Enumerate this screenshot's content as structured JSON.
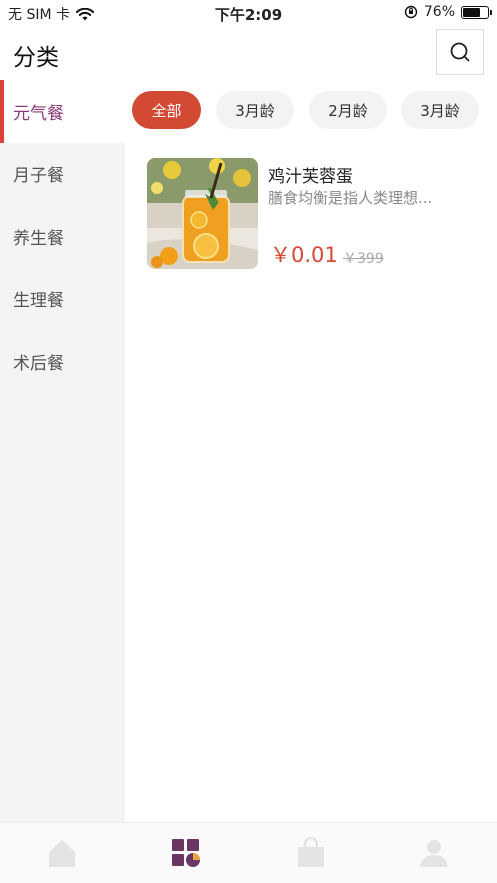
{
  "status_bar": {
    "carrier": "无 SIM 卡",
    "time": "下午2:09",
    "battery": "76%",
    "battery_level": 0.76
  },
  "header": {
    "title": "分类"
  },
  "sidebar": {
    "items": [
      {
        "label": "元气餐",
        "active": true
      },
      {
        "label": "月子餐",
        "active": false
      },
      {
        "label": "养生餐",
        "active": false
      },
      {
        "label": "生理餐",
        "active": false
      },
      {
        "label": "术后餐",
        "active": false
      }
    ]
  },
  "filters": {
    "chips": [
      {
        "label": "全部",
        "active": true
      },
      {
        "label": "3月龄",
        "active": false
      },
      {
        "label": "2月龄",
        "active": false
      },
      {
        "label": "3月龄",
        "active": false
      }
    ]
  },
  "product": {
    "name": "鸡汁芙蓉蛋",
    "description": "膳食均衡是指人类理想...",
    "price": "￥0.01",
    "original_price": "￥399"
  },
  "colors": {
    "accent": "#d24a33",
    "sidebar_active_text": "#8a3a78",
    "sidebar_indicator": "#e0413a",
    "tab_active": "#6b3564"
  },
  "tabbar": {
    "icons": [
      "home-icon",
      "category-icon",
      "bag-icon",
      "user-icon"
    ],
    "active_index": 1
  }
}
